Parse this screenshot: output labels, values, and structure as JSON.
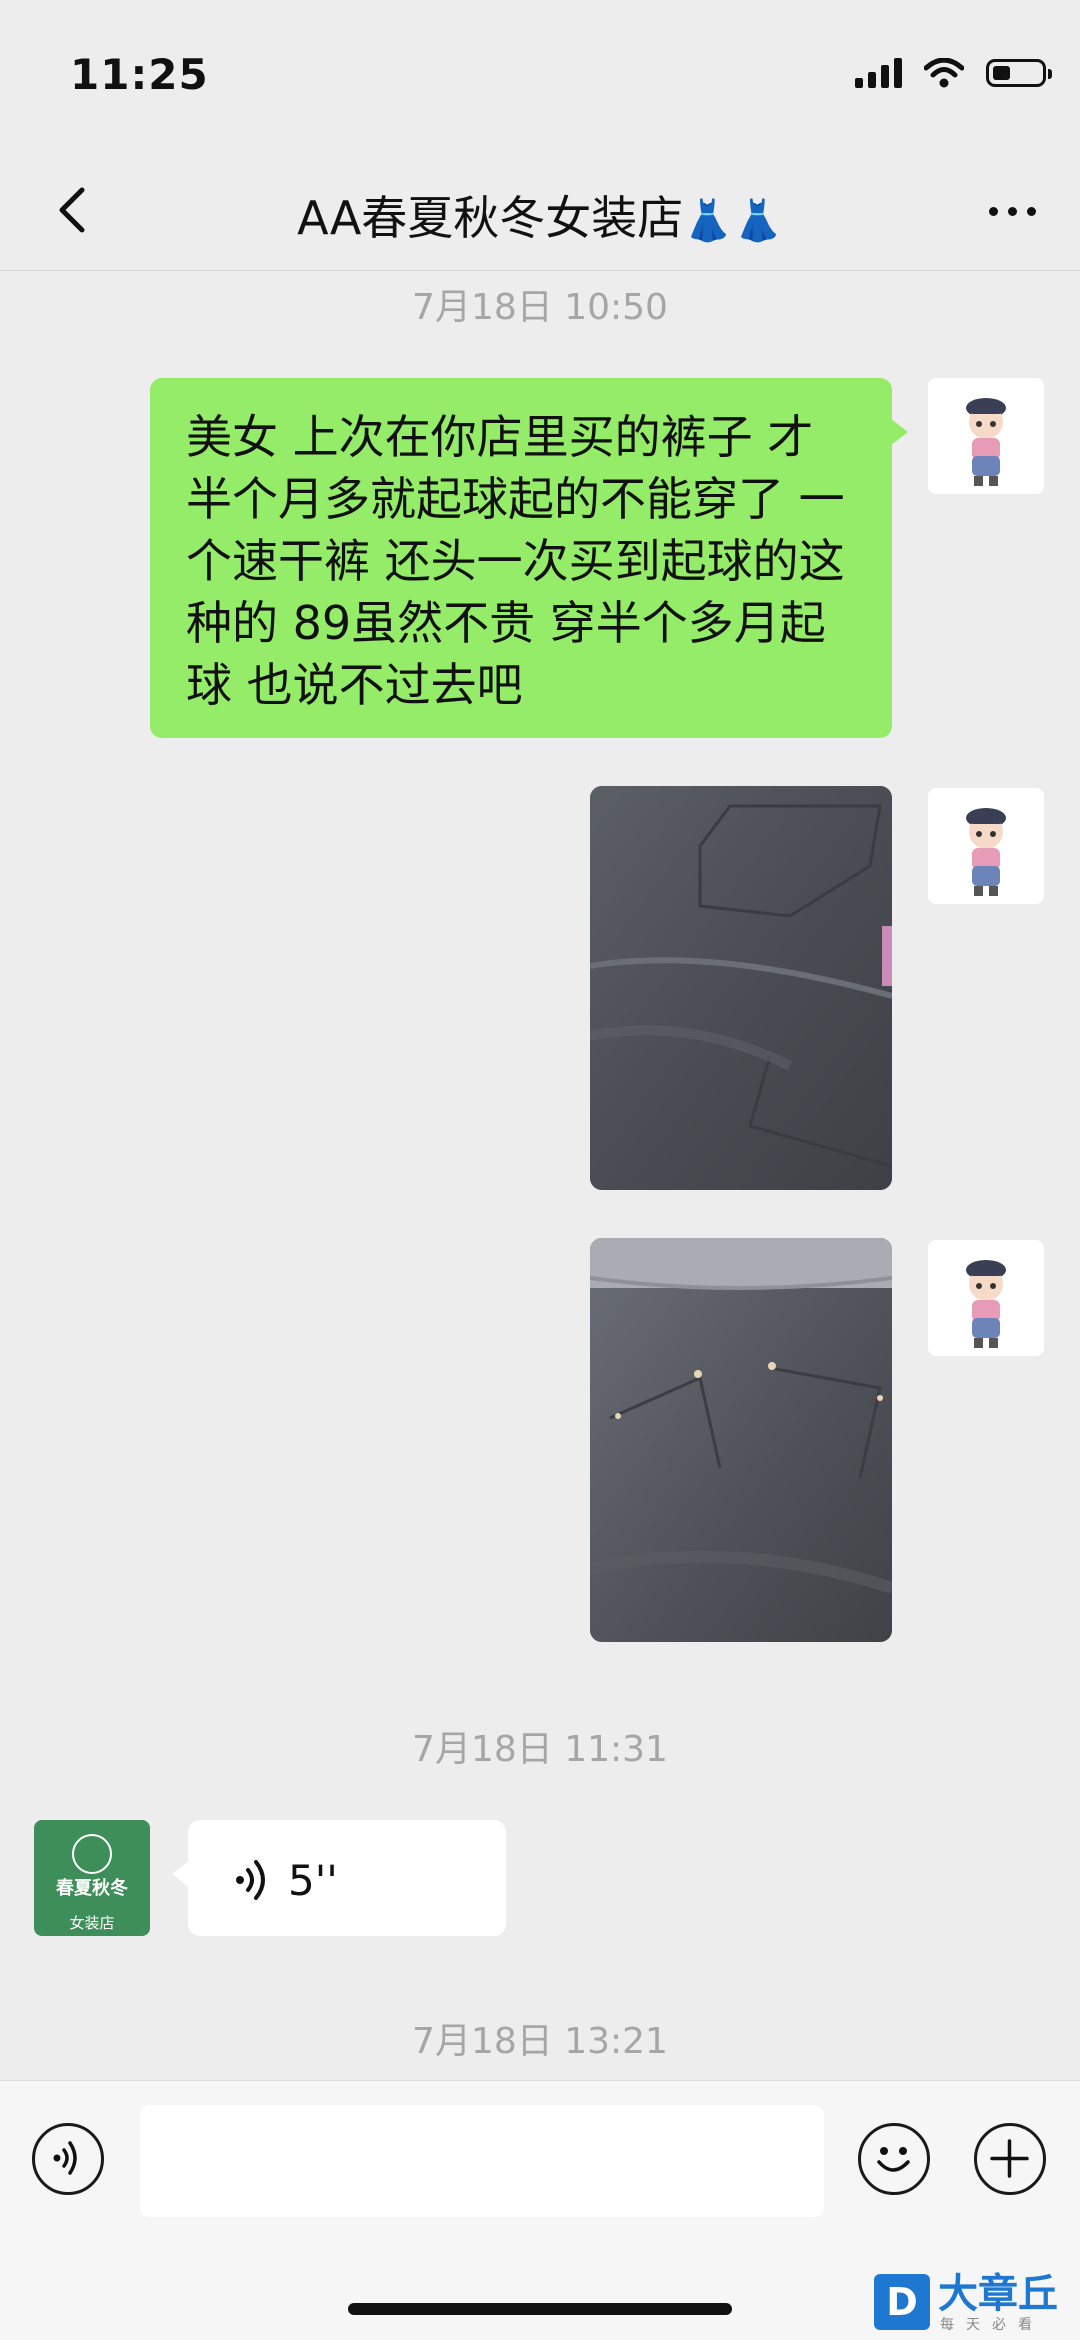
{
  "status_bar": {
    "time": "11:25",
    "battery_level": 0.35
  },
  "header": {
    "title": "AA春夏秋冬女装店",
    "title_emoji": "👗👗"
  },
  "messages": [
    {
      "timestamp": "7月18日 10:50"
    },
    {
      "type": "text",
      "sender": "me",
      "text": "美女 上次在你店里买的裤子 才半个月多就起球起的不能穿了 一个速干裤 还头一次买到起球的这种的 89虽然不贵 穿半个多月起球 也说不过去吧"
    },
    {
      "type": "image",
      "sender": "me",
      "description_icon": "photo"
    },
    {
      "type": "image",
      "sender": "me",
      "description_icon": "photo"
    },
    {
      "timestamp": "7月18日 11:31"
    },
    {
      "type": "voice",
      "sender": "shop",
      "duration": "5''"
    },
    {
      "timestamp": "7月18日 13:21"
    }
  ],
  "shop_avatar": {
    "line1": "春夏秋冬",
    "line2": "女装店"
  },
  "input": {
    "placeholder": ""
  },
  "watermark": {
    "brand": "大章丘",
    "slogan": "每天必看"
  },
  "colors": {
    "bubble_me": "#95ec69",
    "bubble_other": "#ffffff",
    "background": "#ededed",
    "watermark": "#1e78d2"
  }
}
